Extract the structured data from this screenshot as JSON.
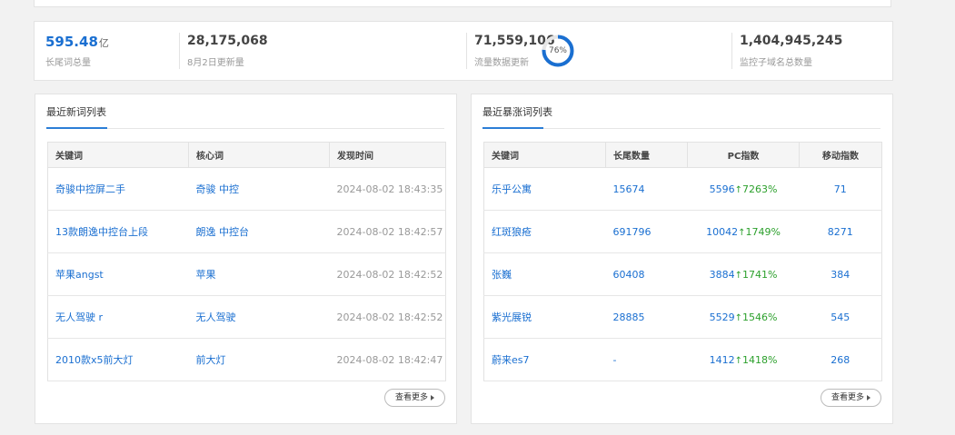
{
  "stats": [
    {
      "value": "595.48",
      "unit": "亿",
      "label": "长尾词总量"
    },
    {
      "value": "28,175,068",
      "label": "8月2日更新量"
    },
    {
      "value": "71,559,106",
      "label": "流量数据更新",
      "progress_percent": 76,
      "progress_text": "76%"
    },
    {
      "value": "1,404,945,245",
      "label": "监控子域名总数量"
    }
  ],
  "colors": {
    "accent": "#1a6fd1",
    "up": "#2ca02c",
    "ring_track": "#e6e6e6"
  },
  "new_words": {
    "title": "最近新词列表",
    "headers": [
      "关键词",
      "核心词",
      "发现时间"
    ],
    "rows": [
      [
        "奇骏中控屏二手",
        "奇骏 中控",
        "2024-08-02 18:43:35"
      ],
      [
        "13款朗逸中控台上段",
        "朗逸 中控台",
        "2024-08-02 18:42:57"
      ],
      [
        "苹果angst",
        "苹果",
        "2024-08-02 18:42:52"
      ],
      [
        "无人驾驶 r",
        "无人驾驶",
        "2024-08-02 18:42:52"
      ],
      [
        "2010款x5前大灯",
        "前大灯",
        "2024-08-02 18:42:47"
      ]
    ],
    "more": "查看更多"
  },
  "surge_words": {
    "title": "最近暴涨词列表",
    "headers": [
      "关键词",
      "长尾数量",
      "PC指数",
      "移动指数"
    ],
    "rows": [
      {
        "kw": "乐乎公寓",
        "count": "15674",
        "pc": "5596",
        "pct": "7263%",
        "mobile": "71"
      },
      {
        "kw": "红斑狼疮",
        "count": "691796",
        "pc": "10042",
        "pct": "1749%",
        "mobile": "8271"
      },
      {
        "kw": "张巍",
        "count": "60408",
        "pc": "3884",
        "pct": "1741%",
        "mobile": "384"
      },
      {
        "kw": "紫光展锐",
        "count": "28885",
        "pc": "5529",
        "pct": "1546%",
        "mobile": "545"
      },
      {
        "kw": "蔚来es7",
        "count": "-",
        "pc": "1412",
        "pct": "1418%",
        "mobile": "268"
      }
    ],
    "more": "查看更多"
  }
}
